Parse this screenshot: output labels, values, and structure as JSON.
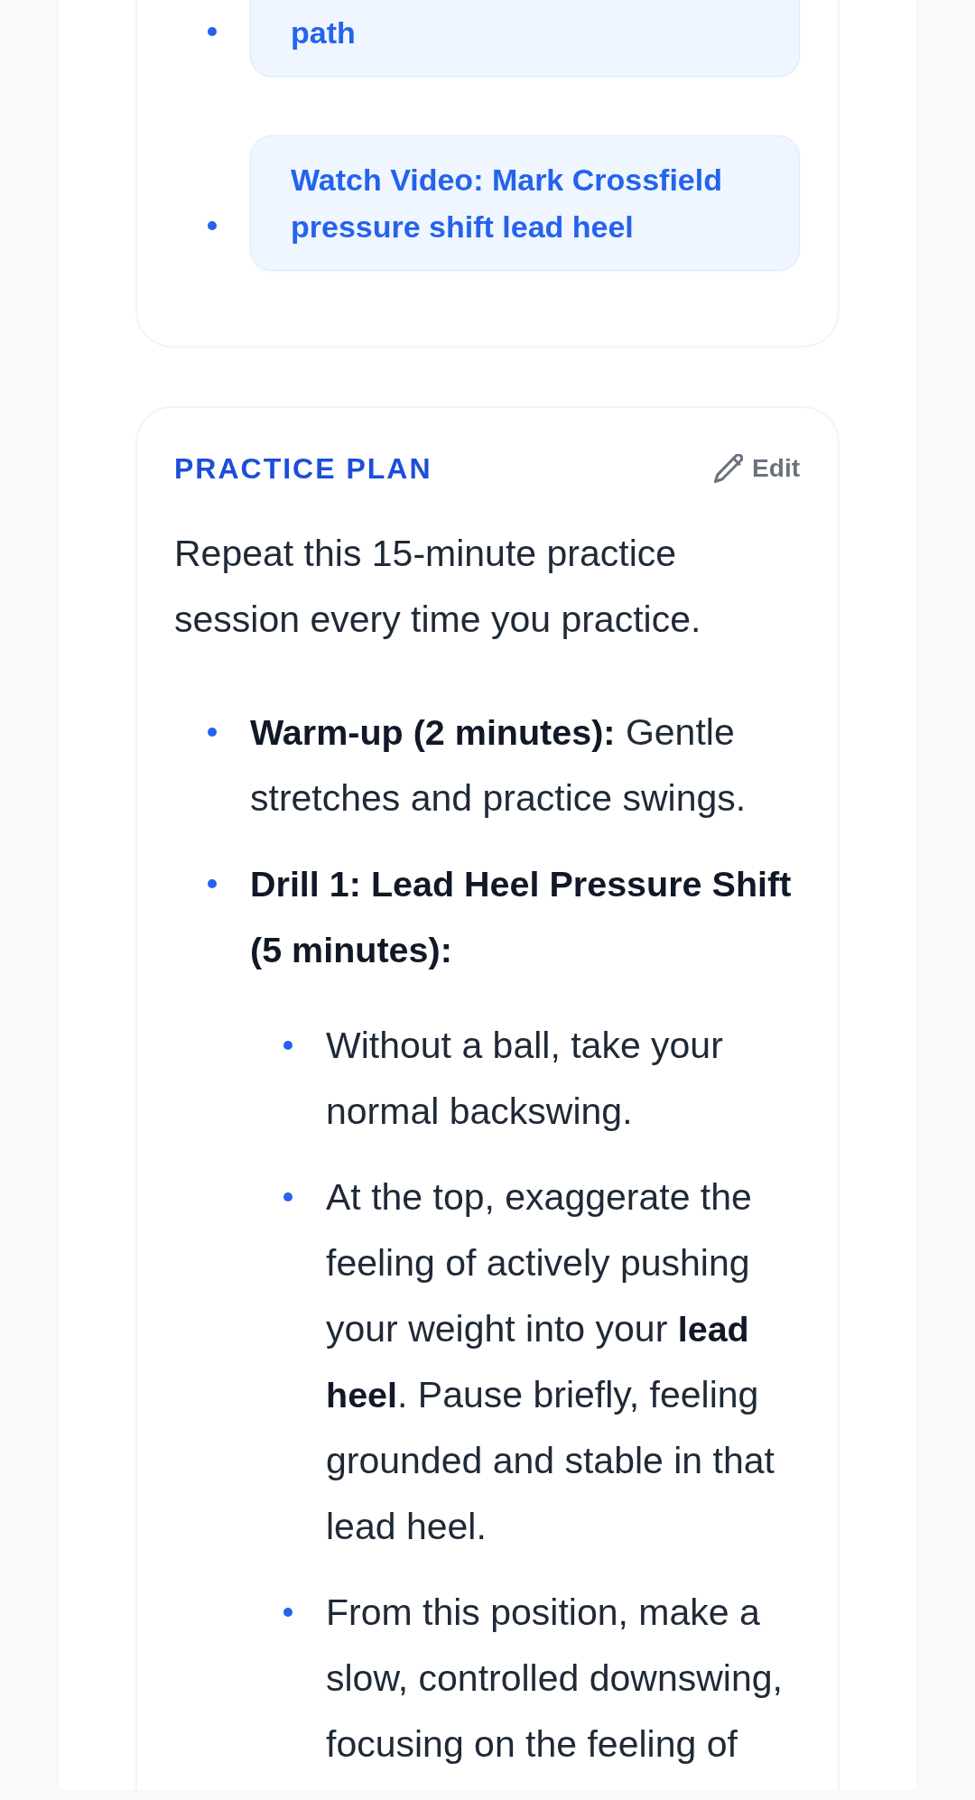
{
  "resources_card": {
    "links": [
      {
        "label": "path"
      },
      {
        "label": "Watch Video: Mark Crossfield pressure shift lead heel"
      }
    ]
  },
  "practice_plan": {
    "title": "PRACTICE PLAN",
    "edit_button": {
      "label": "Edit"
    },
    "intro": "Repeat this 15-minute practice session every time you practice.",
    "items": [
      {
        "text": "**Warm-up (2 minutes):** Gentle stretches and practice swings."
      },
      {
        "text": "**Drill 1: Lead Heel Pressure Shift (5 minutes):**",
        "children": [
          {
            "text": "Without a ball, take your normal backswing."
          },
          {
            "text": "At the top, exaggerate the feeling of actively pushing your weight into your **lead heel**. Pause briefly, feeling grounded and stable in that lead heel."
          },
          {
            "text": "From this position, make a slow, controlled downswing, focusing on the feeling of"
          }
        ]
      }
    ]
  }
}
